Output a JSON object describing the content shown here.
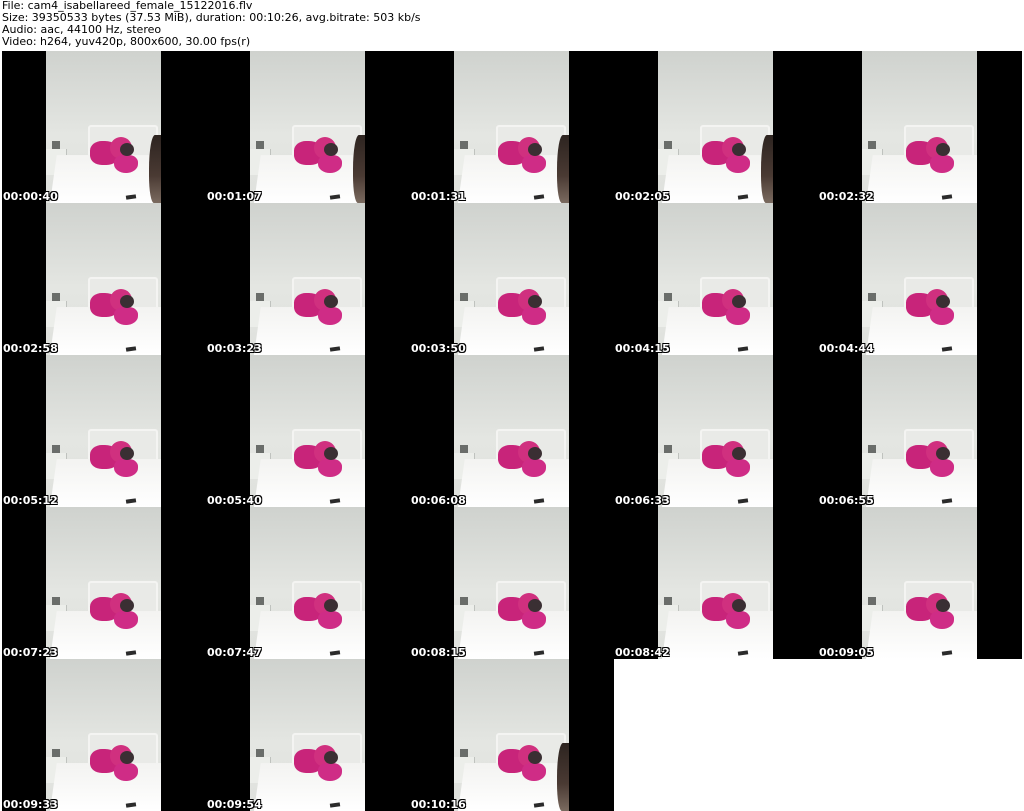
{
  "header": {
    "file": "File: cam4_isabellareed_female_15122016.flv",
    "size": "Size: 39350533 bytes (37.53 MiB), duration: 00:10:26, avg.bitrate: 503 kb/s",
    "audio": "Audio: aac, 44100 Hz, stereo",
    "video": "Video: h264, yuv420p, 800x600, 30.00 fps(r)"
  },
  "thumbnails": [
    {
      "timestamp": "00:00:40",
      "person": true
    },
    {
      "timestamp": "00:01:07",
      "person": true
    },
    {
      "timestamp": "00:01:31",
      "person": true
    },
    {
      "timestamp": "00:02:05",
      "person": true
    },
    {
      "timestamp": "00:02:32",
      "person": false
    },
    {
      "timestamp": "00:02:58",
      "person": false
    },
    {
      "timestamp": "00:03:23",
      "person": false
    },
    {
      "timestamp": "00:03:50",
      "person": false
    },
    {
      "timestamp": "00:04:15",
      "person": false
    },
    {
      "timestamp": "00:04:44",
      "person": false
    },
    {
      "timestamp": "00:05:12",
      "person": false
    },
    {
      "timestamp": "00:05:40",
      "person": false
    },
    {
      "timestamp": "00:06:08",
      "person": false
    },
    {
      "timestamp": "00:06:33",
      "person": false
    },
    {
      "timestamp": "00:06:55",
      "person": false
    },
    {
      "timestamp": "00:07:23",
      "person": false
    },
    {
      "timestamp": "00:07:47",
      "person": false
    },
    {
      "timestamp": "00:08:15",
      "person": false
    },
    {
      "timestamp": "00:08:42",
      "person": false
    },
    {
      "timestamp": "00:09:05",
      "person": false
    },
    {
      "timestamp": "00:09:33",
      "person": false
    },
    {
      "timestamp": "00:09:54",
      "person": false
    },
    {
      "timestamp": "00:10:16",
      "person": true
    }
  ],
  "colors": {
    "letterbox": "#000000",
    "wall": "#dfe1dd",
    "bed": "#ffffff",
    "pillow": "#c8247a",
    "timestamp_text": "#ffffff"
  }
}
